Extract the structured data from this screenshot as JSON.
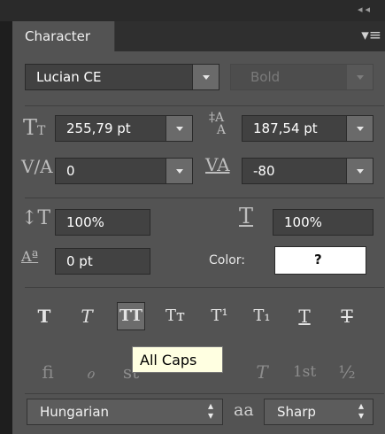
{
  "panel": {
    "tab_label": "Character",
    "menu_icon": "panel-menu-icon",
    "collapse_icon": "collapse-icon"
  },
  "font": {
    "family": "Lucian CE",
    "style": "Bold",
    "style_disabled": true
  },
  "metrics": {
    "size": "255,79 pt",
    "leading": "187,54 pt",
    "kerning": "0",
    "tracking": "-80",
    "vertical_scale": "100%",
    "horizontal_scale": "100%",
    "baseline_shift": "0 pt"
  },
  "color": {
    "label": "Color:",
    "swatch_text": "?",
    "swatch_color": "#ffffff"
  },
  "type_buttons": [
    {
      "name": "faux-bold",
      "glyph": "T"
    },
    {
      "name": "faux-italic",
      "glyph": "T"
    },
    {
      "name": "all-caps",
      "glyph": "TT",
      "active": true
    },
    {
      "name": "small-caps",
      "glyph": "Tт"
    },
    {
      "name": "superscript",
      "glyph": "T¹"
    },
    {
      "name": "subscript",
      "glyph": "T₁"
    },
    {
      "name": "underline",
      "glyph": "T"
    },
    {
      "name": "strikethrough",
      "glyph": "T"
    }
  ],
  "opentype_buttons": [
    {
      "name": "ligatures",
      "glyph": "fi"
    },
    {
      "name": "discretionary-ligatures",
      "glyph": "ℴ"
    },
    {
      "name": "swash",
      "glyph": "st"
    },
    {
      "name": "titling",
      "glyph": "T"
    },
    {
      "name": "ordinals",
      "glyph": "1st"
    },
    {
      "name": "fractions",
      "glyph": "½"
    }
  ],
  "tooltip": "All Caps",
  "language": "Hungarian",
  "antialias_icon_text": "aa",
  "antialias": "Sharp"
}
